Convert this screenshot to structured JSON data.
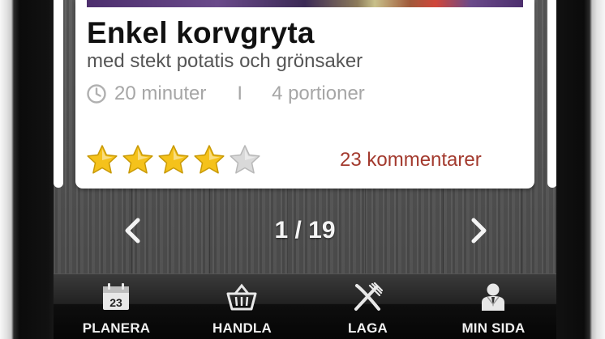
{
  "recipe": {
    "title": "Enkel korvgryta",
    "subtitle": "med stekt potatis och grönsaker",
    "time": "20 minuter",
    "separator": "I",
    "servings": "4 portioner",
    "rating": 4,
    "rating_max": 5,
    "comments": "23 kommentarer"
  },
  "pager": {
    "current": "1 / 19",
    "prev_icon": "chevron-left-icon",
    "next_icon": "chevron-right-icon"
  },
  "tabs": [
    {
      "label": "PLANERA",
      "icon": "calendar-icon",
      "day": "23"
    },
    {
      "label": "HANDLA",
      "icon": "basket-icon"
    },
    {
      "label": "LAGA",
      "icon": "fork-knife-icon"
    },
    {
      "label": "MIN SIDA",
      "icon": "user-icon"
    }
  ],
  "colors": {
    "comment_link": "#a33a2e",
    "meta_text": "#a6a6a6",
    "star_filled": "#f5c21b",
    "star_empty": "#d9d9d9"
  }
}
